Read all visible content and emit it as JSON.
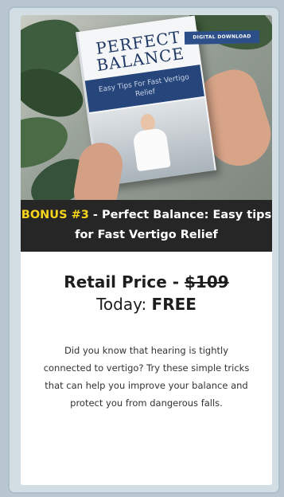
{
  "book": {
    "title_line1": "PERFECT",
    "title_line2": "BALANCE",
    "subtitle": "Easy Tips For Fast Vertigo Relief"
  },
  "badge": "DIGITAL DOWNLOAD",
  "caption": {
    "bonus_label": "BONUS #3",
    "rest": " - Perfect Balance: Easy tips for Fast Vertigo Relief"
  },
  "price": {
    "retail_label": "Retail Price - ",
    "retail_value": "$109",
    "today_label": "Today: ",
    "today_value": "FREE"
  },
  "description": "Did you know that hearing is tightly connected to vertigo? Try these simple tricks that can help you improve your balance and protect you from dangerous falls.",
  "colors": {
    "bonus_accent": "#f7d51d",
    "caption_bg": "#262626",
    "badge_bg": "#2c4f89",
    "book_navy": "#1f3763"
  }
}
